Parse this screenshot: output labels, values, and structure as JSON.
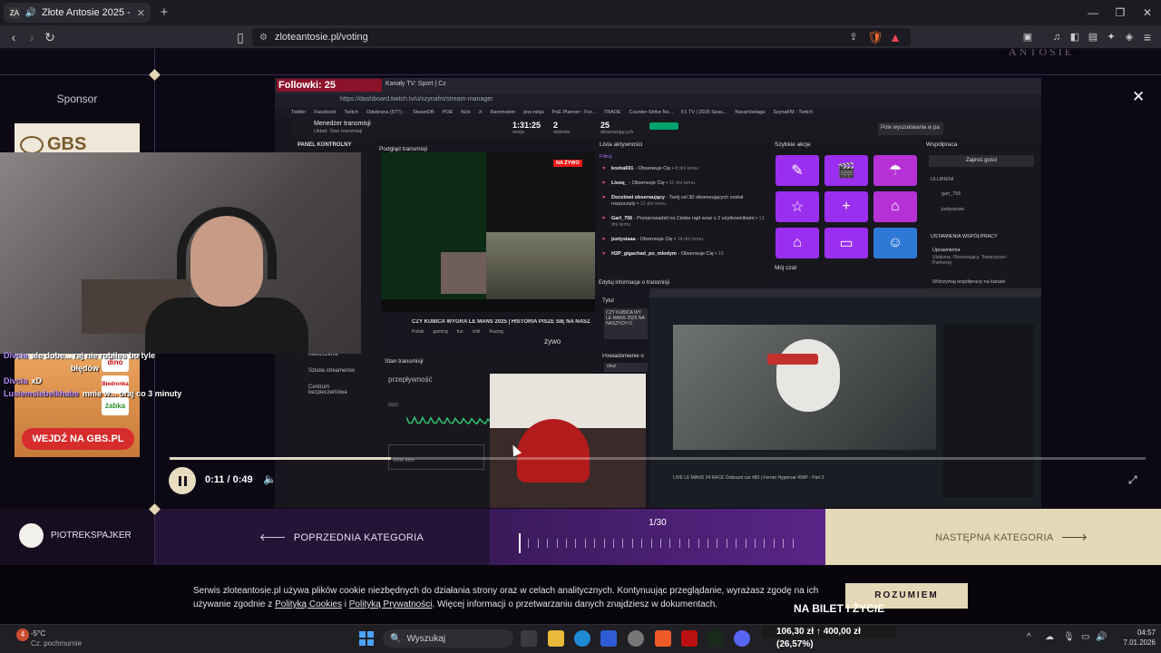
{
  "browser": {
    "tab_title": "Złote Antosie 2025 - Największ",
    "url": "zloteantosie.pl/voting",
    "new_tab": "+",
    "extension_badge": "1"
  },
  "page": {
    "sponsor_label": "Sponsor",
    "sponsor_ad": {
      "brand": "GBS",
      "cta": "WEJDŹ NA GBS.PL",
      "partners": [
        "dino",
        "Biedronka",
        "żabka"
      ]
    },
    "video": {
      "follow_counter": "Followki: 25",
      "dashboard_url": "https://dashboard.twitch.tv/u/szynafm/stream-manager",
      "tab_label": "Kanały TV: Sport | Cz",
      "bookmarks": [
        "Twitter",
        "Facebook",
        "Twitch",
        "Odebrana (577) -",
        "SteamDB",
        "POE",
        "Kick",
        "X",
        "Rammstein",
        "poe.ninja",
        "PoE Planner - For...",
        "TRADE",
        "Counter-Strike Ne...",
        "F1 TV | 2025 Seas...",
        "Narambelaga",
        "SzynaFM - Twitch"
      ],
      "stream_manager": "Menedżer transmisji",
      "stream_manager_sub": "Układ: Stan transmisji",
      "session_time": "1:31:25",
      "session_label": "sesja",
      "viewers": "2",
      "viewers_label": "widzów",
      "followers": "25",
      "followers_label": "obserwujących",
      "panel_title": "PANEL KONTROLNY",
      "preview_title": "Podgląd transmisji",
      "live_badge": "NA ŻYWO",
      "activity_title": "Lista aktywności",
      "activity_filter": "Filtruj",
      "activity": [
        {
          "name": "kozka691",
          "text": "Obserwuje Cię",
          "when": "8 dni temu"
        },
        {
          "name": "Lisoq_",
          "text": "Obserwuje Cię",
          "when": "11 dni temu"
        },
        {
          "name": "Docelowi obserwujący",
          "text": "Twój cel 30 obserwujących został rozpoczęty",
          "when": "12 dni temu"
        },
        {
          "name": "Garl_756",
          "text": "Przeprowadził na Ciebie rajd wraz z 2 użytkownikami",
          "when": "13 dni temu"
        },
        {
          "name": "justysiaaa",
          "text": "Obserwuje Cię",
          "when": "14 dni temu"
        },
        {
          "name": "H2P_gigachad_po_mlodym",
          "text": "Obserwuje Cię",
          "when": "16"
        }
      ],
      "quick_actions_title": "Szybkie akcje",
      "quick_actions": [
        "✎",
        "🎬",
        "☂",
        "☆",
        "+",
        "⌂",
        "⌂",
        "▭",
        "☺"
      ],
      "cooperation_title": "Współpraca",
      "invite_guests": "Zaproś gości",
      "favorites_label": "ULUBIENI",
      "favorites": [
        "garl_756",
        "justysiuwu"
      ],
      "coop_settings": "USTAWIENIA WSPÓŁPRACY",
      "coop_permissions": "Uprawnienia",
      "coop_permissions_sub": "Ulubione, Obserwujący, Towarzysze i Partnerzy",
      "coop_pause": "Wstrzymaj współpracę na kanale",
      "my_chat": "Mój czat",
      "edit_stream_info": "Edytuj informacje o transmisji",
      "title_label": "Tytuł",
      "stream_title": "CZY KUBICA WYGRA LE MANS 2025 | HISTORIA PISZE SIĘ NA NASZ",
      "stream_title_short": "CZY KUBICA WY LE MANS 2025 NA NASZYCH O",
      "stream_tags": [
        "Polski",
        "gaming",
        "fun",
        "chill",
        "Racing"
      ],
      "live_word": "żywo",
      "notification_label": "Powiadomienie o",
      "notification_value": "chuć",
      "stream_status": "Stan transmisji",
      "bitrate_label": "przepływność",
      "bitrate_axis": "5000",
      "bitrate_value": "3006 kb/s",
      "sidebar_items": [
        "Mieszczenie",
        "Szkoła streamerów",
        "Centrum bezpieczeństwa"
      ],
      "chat_overlay": [
        {
          "user": "Divcia",
          "text": "ale dobe... raj nie robiłes bo tyle"
        },
        {
          "user": "",
          "text": "błędów"
        },
        {
          "user": "Divcia",
          "text": "xD"
        },
        {
          "user": "Lusiemsiebelkhabe",
          "text": "mnie w... oraj co 3 minuty"
        }
      ],
      "inner_stream_title": "LIVE LE MANS 24 RACE Onboard car #83 | Ferrari Hypercar 499P - Part 3",
      "current_time": "0:11",
      "duration": "0:49",
      "time_separator": " / ",
      "progress": 0.227
    },
    "nav": {
      "user_name": "PIOTREKSPAJKER",
      "prev_label": "POPRZEDNIA KATEGORIA",
      "counter": "1/30",
      "next_label": "NASTĘPNA KATEGORIA",
      "total_ticks": 30,
      "current_tick": 1
    },
    "cookie": {
      "text_1": "Serwis zloteantosie.pl używa plików cookie niezbędnych do działania strony oraz w celach analitycznych. Kontynuując przeglądanie, wyrażasz zgodę na ich używanie zgodnie z ",
      "link_cookies": "Polityką Cookies",
      "text_and": " i ",
      "link_privacy": "Polityką Prywatności",
      "text_2": ". Więcej informacji o przetwarzaniu danych znajdziesz w dokumentach.",
      "accept": "ROZUMIEM"
    },
    "ticker": "NA BILET I ŻYCIE"
  },
  "taskbar": {
    "weather_temp": "-5°C",
    "weather_desc": "Cz. pochmurnie",
    "weather_badge": "4",
    "search": "Wyszukaj",
    "stock": "106,30 zł  ↑ 400,00 zł (26,57%)",
    "time": "04:57",
    "date": "7.01.2026"
  },
  "colors": {
    "accent_gold": "#e5d8b7",
    "accent_purple": "#5a2488",
    "qa_purple": "#9b2ff0",
    "qa_magenta": "#b531d6",
    "qa_blue": "#2e79d6"
  }
}
